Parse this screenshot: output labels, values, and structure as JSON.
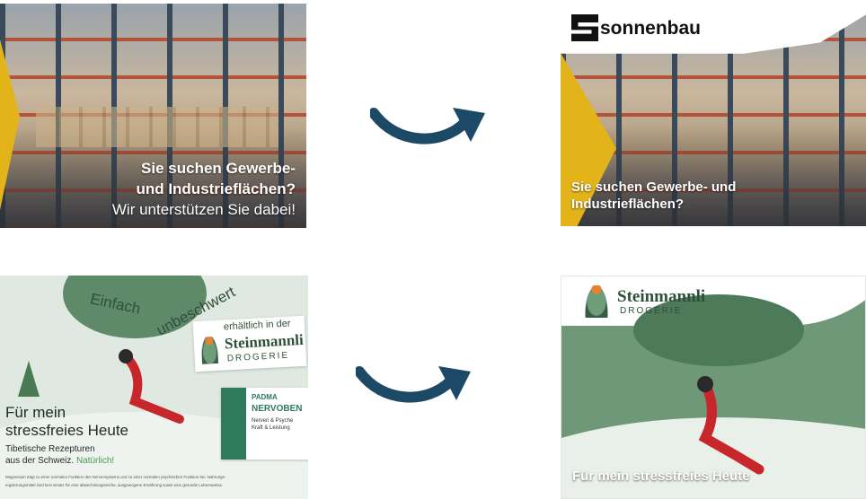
{
  "top_left": {
    "headline_line1": "Sie suchen Gewerbe-",
    "headline_line2": "und Industrieflächen?",
    "subline": "Wir unterstützen Sie dabei!"
  },
  "top_right": {
    "brand": "sonnenbau",
    "headline_line1": "Sie suchen Gewerbe- und",
    "headline_line2": "Industrieflächen?"
  },
  "bottom_left": {
    "arc_word1": "Einfach",
    "arc_word2": "unbeschwert",
    "badge_line1": "erhältlich in der",
    "badge_brand": "Steinmannli",
    "badge_sub": "DROGERIE",
    "headline_line1": "Für mein",
    "headline_line2": "stressfreies Heute",
    "sub_line1": "Tibetische Rezepturen",
    "sub_line2": "aus der Schweiz.",
    "sub_highlight": "Natürlich!",
    "product_brand": "PADMA",
    "product_name": "NERVOBEN",
    "product_desc1": "Nerven & Psyche",
    "product_desc2": "Kraft & Leistung",
    "fineprint1": "Magnesium trägt zu einer normalen Funktion des Nervensystems und zu einer normalen psychischen Funktion bei. Nahrungs-",
    "fineprint2": "ergänzungsmittel sind kein Ersatz für eine abwechslungsreiche, ausgewogene Ernährung sowie eine gesunde Lebensweise."
  },
  "bottom_right": {
    "brand": "Steinmannli",
    "brand_sub": "DROGERIE",
    "headline": "Für mein stressfreies Heute"
  },
  "colors": {
    "arrow": "#1c4a66",
    "yellow": "#e2b41a",
    "green": "#5f8a69",
    "red": "#c7262b"
  }
}
